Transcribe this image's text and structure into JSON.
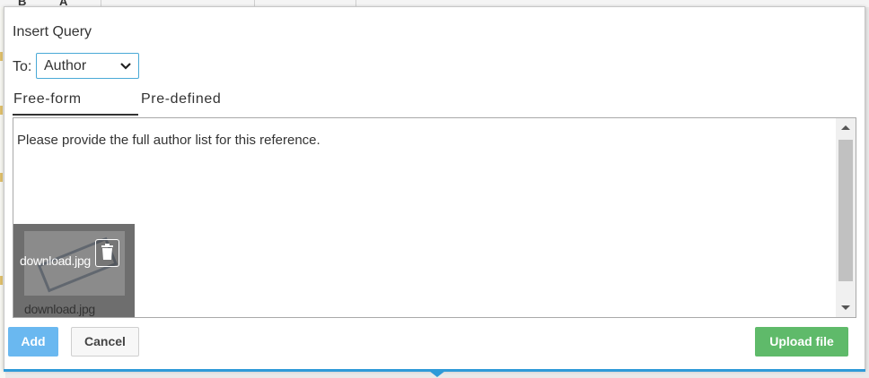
{
  "dialog": {
    "title": "Insert Query",
    "to_label": "To:",
    "recipient_selected": "Author"
  },
  "tabs": [
    {
      "label": "Free-form",
      "active": true
    },
    {
      "label": "Pre-defined",
      "active": false
    }
  ],
  "editor": {
    "text": "Please provide the full author list for this reference."
  },
  "attachment": {
    "overlay_name": "download.jpg",
    "caption": "download.jpg"
  },
  "buttons": {
    "add": "Add",
    "cancel": "Cancel",
    "upload": "Upload file"
  },
  "colors": {
    "accent_blue": "#2e9ad8",
    "add_button": "#6ab8f0",
    "upload_button": "#5fba6a",
    "select_border": "#49a9d6"
  },
  "icons": [
    "chevron-down-icon",
    "trash-icon",
    "scroll-up-arrow-icon",
    "scroll-down-arrow-icon"
  ]
}
